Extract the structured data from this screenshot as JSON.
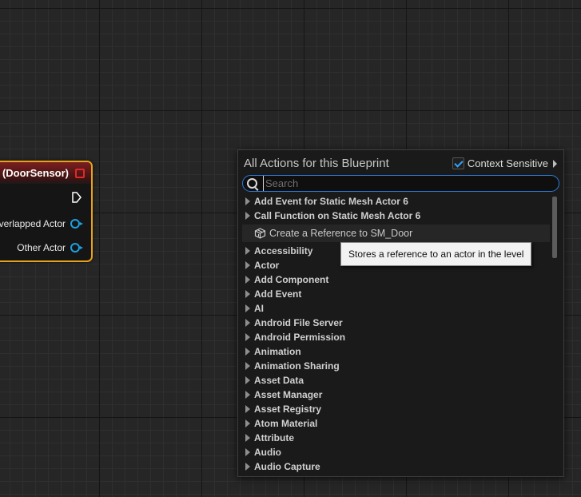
{
  "node": {
    "title": "(DoorSensor)",
    "pins": [
      "verlapped Actor",
      "Other Actor"
    ]
  },
  "menu": {
    "title": "All Actions for this Blueprint",
    "context_label": "Context Sensitive",
    "context_checked": true,
    "search": {
      "value": "",
      "placeholder": "Search"
    },
    "top_items": [
      "Add Event for Static Mesh Actor 6",
      "Call Function on Static Mesh Actor 6"
    ],
    "child_item": "Create a Reference to SM_Door",
    "items": [
      "Accessibility",
      "Actor",
      "Add Component",
      "Add Event",
      "AI",
      "Android File Server",
      "Android Permission",
      "Animation",
      "Animation Sharing",
      "Asset Data",
      "Asset Manager",
      "Asset Registry",
      "Atom Material",
      "Attribute",
      "Audio",
      "Audio Capture"
    ],
    "tooltip": "Stores a reference to an actor in the level"
  },
  "colors": {
    "node_border": "#e8a21a",
    "node_header": "#7a1f1f",
    "object_pin": "#1da0e0",
    "search_border": "#2e7ad6"
  }
}
